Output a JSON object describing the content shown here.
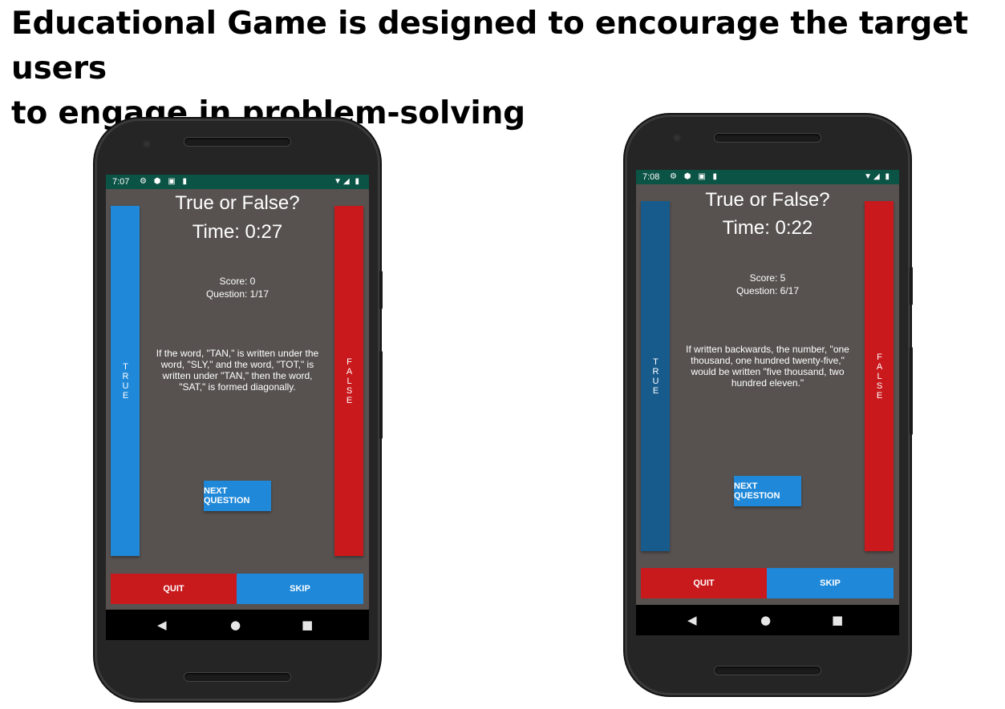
{
  "heading": {
    "line1": "Educational Game is designed to encourage the target users",
    "line2": "to engage in problem-solving"
  },
  "colors": {
    "true_blue": "#1f88d9",
    "true_blue_dark": "#175b8d",
    "false_red": "#c9191c",
    "quit_red": "#c8191d",
    "status_green": "#0b5345",
    "screen_gray": "#575250"
  },
  "screens": [
    {
      "status_time": "7:07",
      "status_icons": "⚙ ⬢ ▣ ▮",
      "status_right": "▼◢ ▮",
      "title": "True or False?",
      "timer": "Time: 0:27",
      "score": "Score: 0",
      "question_count": "Question: 1/17",
      "question": "If the word, \"TAN,\" is written under the word, \"SLY,\" and the word, \"TOT,\" is written under \"TAN,\" then the word, \"SAT,\" is formed diagonally.",
      "true_label": "TRUE",
      "false_label": "FALSE",
      "next_label": "NEXT QUESTION",
      "quit_label": "QUIT",
      "skip_label": "SKIP",
      "nav": {
        "back": "◀",
        "home": "●",
        "recents": "■"
      }
    },
    {
      "status_time": "7:08",
      "status_icons": "⚙ ⬢ ▣ ▮",
      "status_right": "▼◢ ▮",
      "title": "True or False?",
      "timer": "Time: 0:22",
      "score": "Score: 5",
      "question_count": "Question: 6/17",
      "question": "If written backwards, the number, \"one thousand, one hundred twenty-five,\" would be written \"five thousand, two hundred eleven.\"",
      "true_label": "TRUE",
      "false_label": "FALSE",
      "next_label": "NEXT QUESTION",
      "quit_label": "QUIT",
      "skip_label": "SKIP",
      "nav": {
        "back": "◀",
        "home": "●",
        "recents": "■"
      }
    }
  ]
}
